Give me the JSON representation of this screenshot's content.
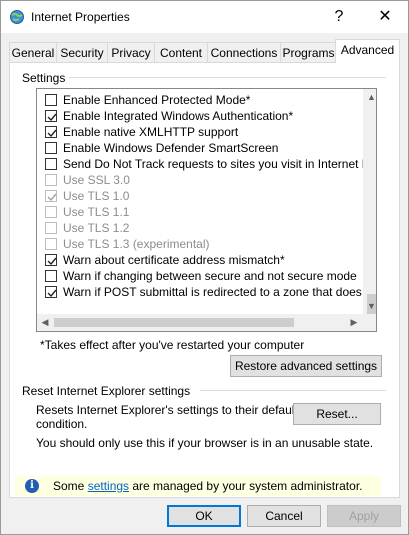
{
  "window": {
    "title": "Internet Properties",
    "help_glyph": "?",
    "close_glyph": "✕"
  },
  "tabs": [
    {
      "label": "General"
    },
    {
      "label": "Security"
    },
    {
      "label": "Privacy"
    },
    {
      "label": "Content"
    },
    {
      "label": "Connections"
    },
    {
      "label": "Programs"
    },
    {
      "label": "Advanced",
      "active": true
    }
  ],
  "settings": {
    "group_label": "Settings",
    "items": [
      {
        "label": "Enable Enhanced Protected Mode*",
        "checked": false,
        "disabled": false
      },
      {
        "label": "Enable Integrated Windows Authentication*",
        "checked": true,
        "disabled": false
      },
      {
        "label": "Enable native XMLHTTP support",
        "checked": true,
        "disabled": false
      },
      {
        "label": "Enable Windows Defender SmartScreen",
        "checked": false,
        "disabled": false
      },
      {
        "label": "Send Do Not Track requests to sites you visit in Internet E",
        "checked": false,
        "disabled": false
      },
      {
        "label": "Use SSL 3.0",
        "checked": false,
        "disabled": true
      },
      {
        "label": "Use TLS 1.0",
        "checked": true,
        "disabled": true
      },
      {
        "label": "Use TLS 1.1",
        "checked": false,
        "disabled": true
      },
      {
        "label": "Use TLS 1.2",
        "checked": false,
        "disabled": true
      },
      {
        "label": "Use TLS 1.3 (experimental)",
        "checked": false,
        "disabled": true
      },
      {
        "label": "Warn about certificate address mismatch*",
        "checked": true,
        "disabled": false
      },
      {
        "label": "Warn if changing between secure and not secure mode",
        "checked": false,
        "disabled": false
      },
      {
        "label": "Warn if POST submittal is redirected to a zone that does n",
        "checked": true,
        "disabled": false
      }
    ],
    "footnote": "*Takes effect after you've restarted your computer",
    "restore_button": "Restore advanced settings"
  },
  "reset": {
    "group_label": "Reset Internet Explorer settings",
    "description_line1": "Resets Internet Explorer's settings to their default",
    "description_line2": "condition.",
    "button": "Reset...",
    "warning": "You should only use this if your browser is in an unusable state."
  },
  "infobar": {
    "prefix": "Some ",
    "link": "settings",
    "suffix": " are managed by your system administrator.",
    "icon": "info-icon"
  },
  "footer": {
    "ok": "OK",
    "cancel": "Cancel",
    "apply": "Apply"
  }
}
